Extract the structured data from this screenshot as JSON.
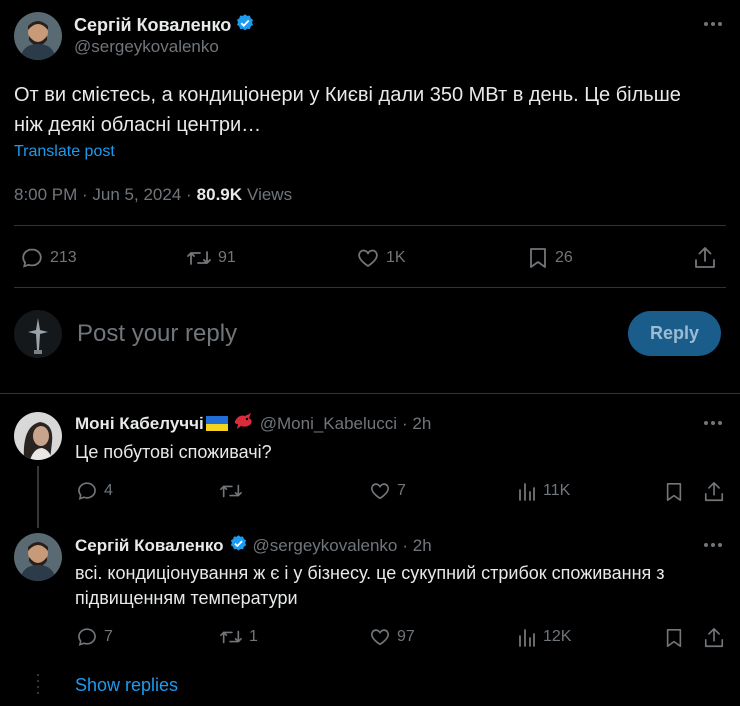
{
  "post": {
    "author_name": "Сергій Коваленко",
    "author_handle": "@sergeykovalenko",
    "text_line1": "От ви смієтесь, а кондиціонери у Києві дали 350 МВт в день. Це більше",
    "text_line2": "ніж деякі обласні центри…",
    "translate_label": "Translate post",
    "timestamp": "8:00 PM · Jun 5, 2024 ·",
    "views_count": "80.9K",
    "views_label": "Views",
    "replies": "213",
    "reposts": "91",
    "likes": "1K",
    "bookmarks": "26"
  },
  "composer": {
    "placeholder": "Post your reply",
    "reply_label": "Reply"
  },
  "replies": [
    {
      "author_name": "Моні Кабелуччі",
      "author_handle": "@Moni_Kabelucci",
      "time": "· 2h",
      "text": "Це побутові споживачі?",
      "replies": "4",
      "reposts": "",
      "likes": "7",
      "views": "11K"
    },
    {
      "author_name": "Сергій Коваленко",
      "author_handle": "@sergeykovalenko",
      "time": "· 2h",
      "text_line1": "всі. кондиціонування ж є і у бізнесу. це сукупний стрибок споживання з",
      "text_line2": "підвищенням температури",
      "replies": "7",
      "reposts": "1",
      "likes": "97",
      "views": "12K"
    }
  ],
  "show_replies_label": "Show replies",
  "colors": {
    "background": "#000000",
    "text": "#e7e9ea",
    "muted": "#71767b",
    "accent": "#1d9bf0",
    "divider": "#2f3336"
  }
}
